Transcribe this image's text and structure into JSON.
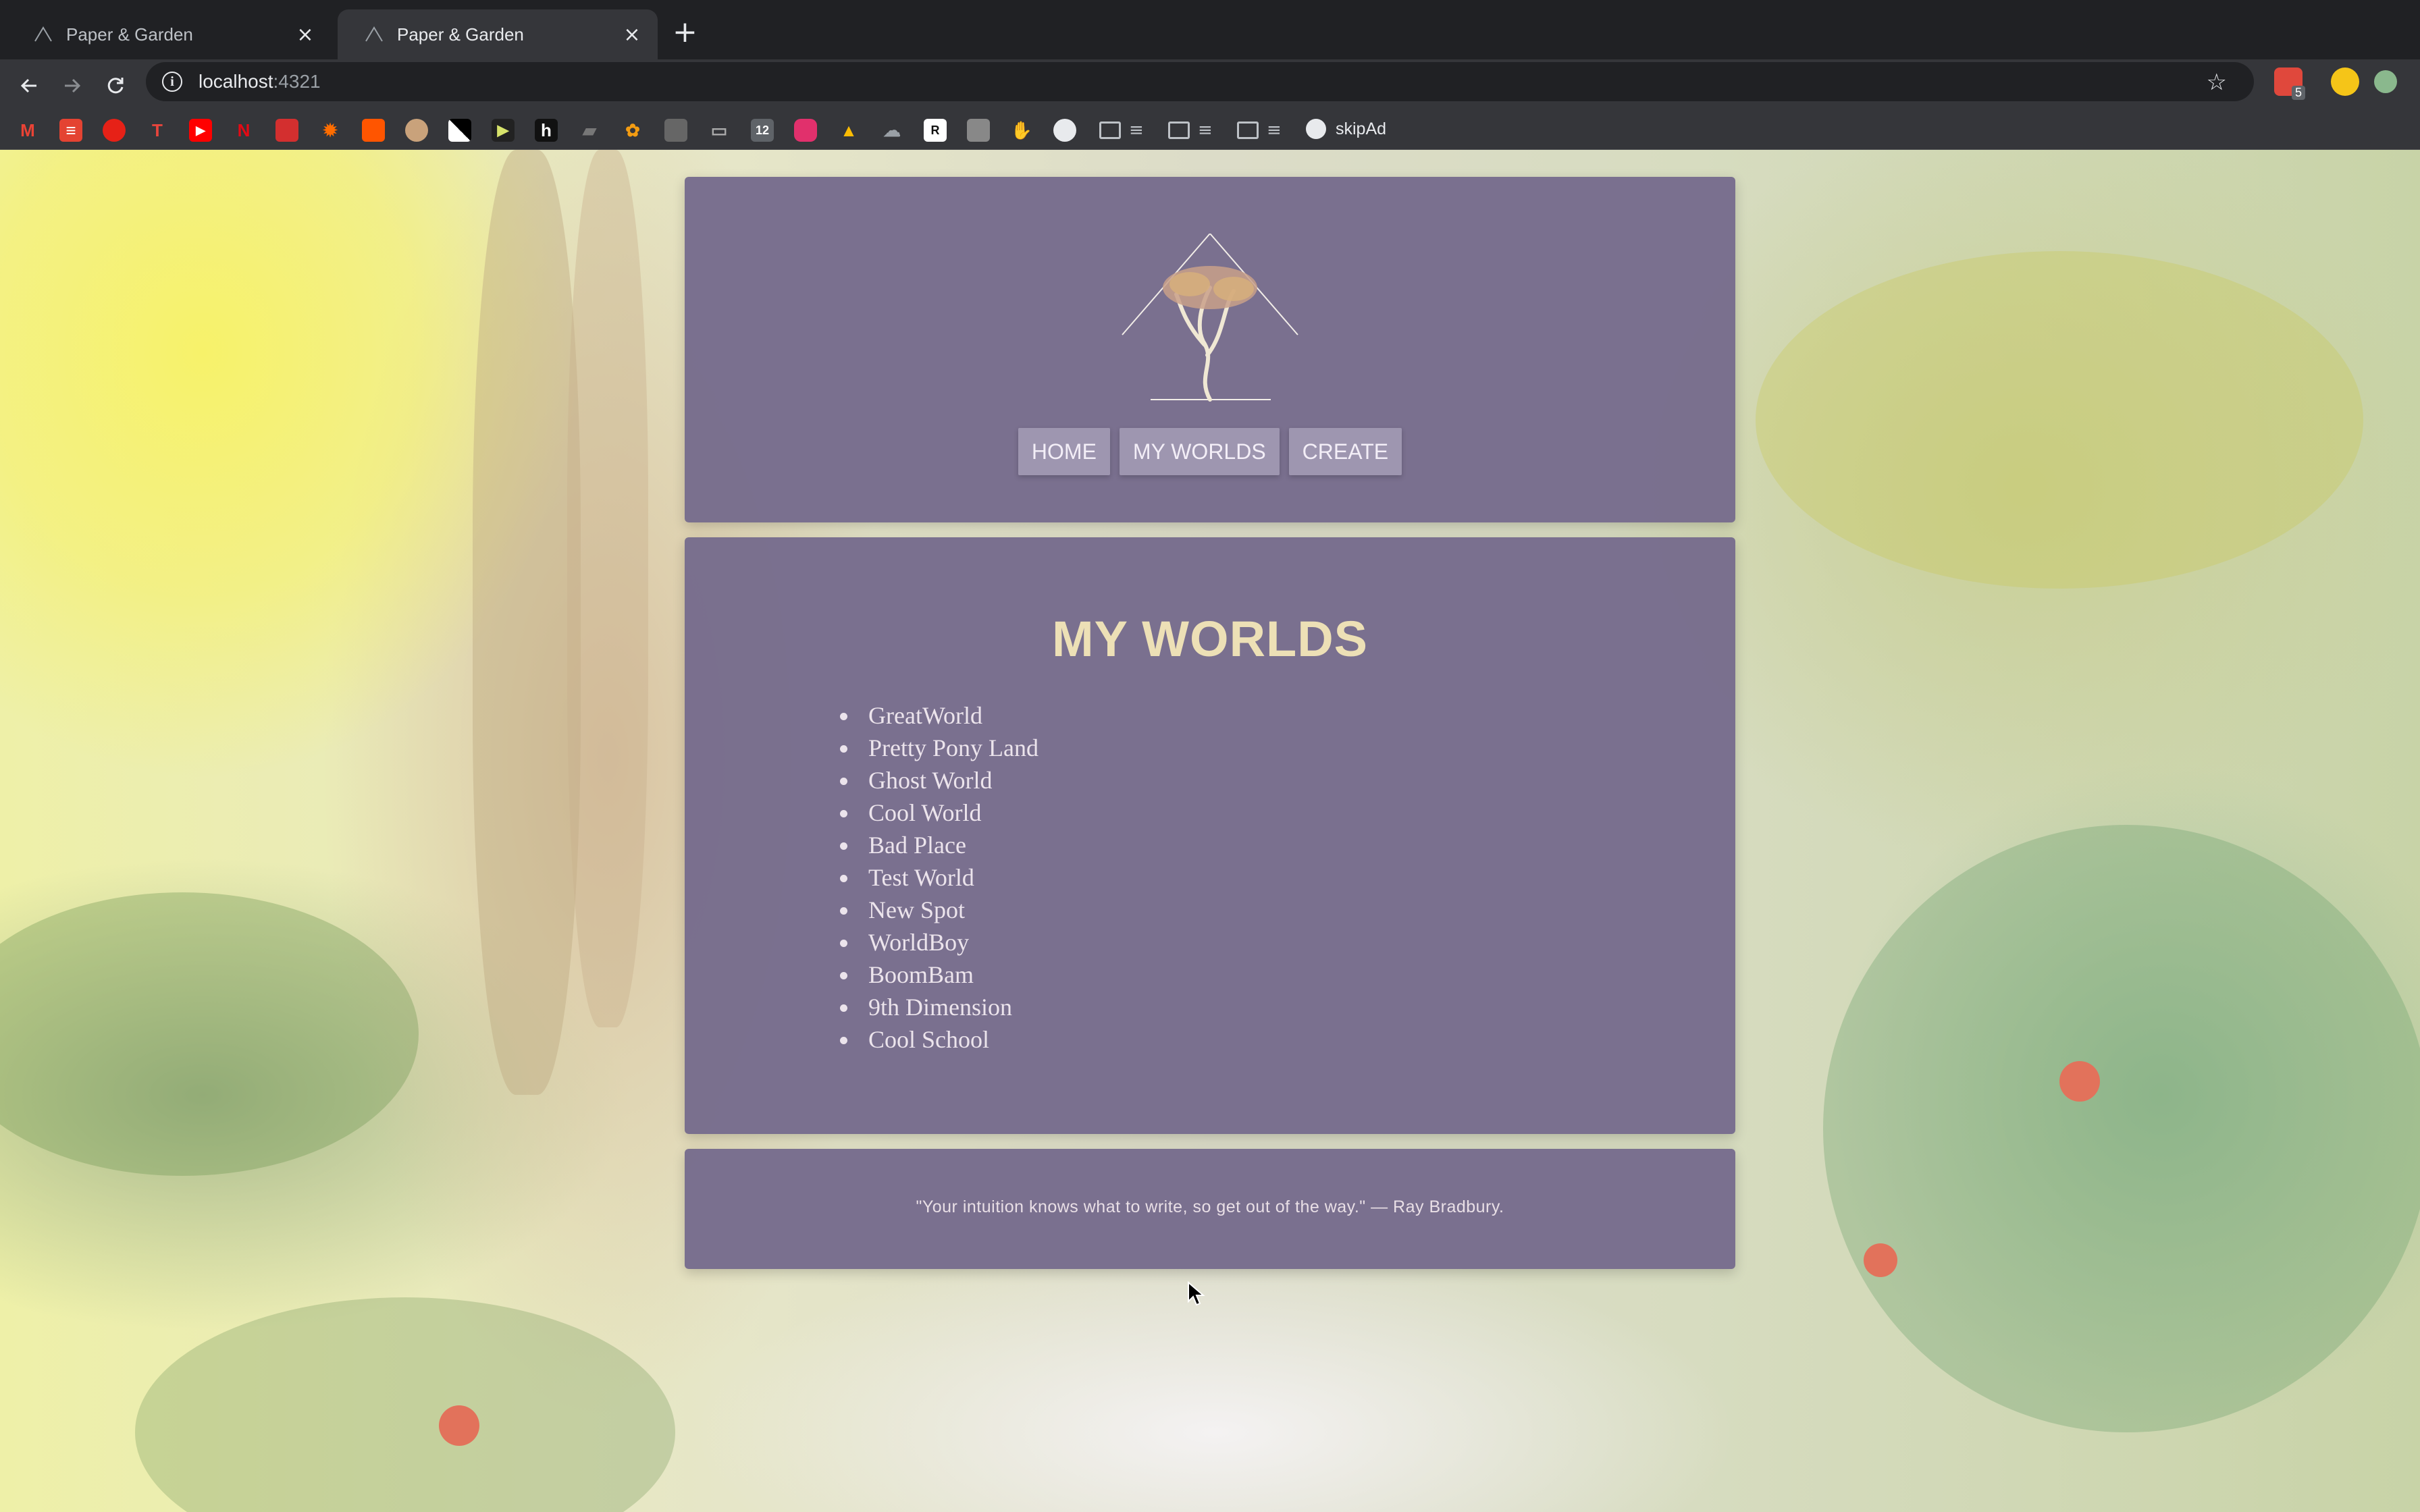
{
  "browser": {
    "tabs": [
      {
        "title": "Paper & Garden",
        "active": false
      },
      {
        "title": "Paper & Garden",
        "active": true
      }
    ],
    "url": {
      "host": "localhost",
      "port": ":4321"
    },
    "extension_badge": "5",
    "bookmark_skip_label": "skipAd",
    "bookmark_icons": [
      "gmail-icon",
      "todoist-icon",
      "record-icon",
      "t-icon",
      "youtube-icon",
      "netflix-icon",
      "acrobat-icon",
      "settings-sun-icon",
      "soundcloud-icon",
      "avatar-icon",
      "checker-icon",
      "film-icon",
      "h-icon",
      "stripe-icon",
      "paint-icon",
      "puzzle-icon",
      "tag-icon",
      "calendar-12-icon",
      "instagram-icon",
      "drive-icon",
      "cloud-icon",
      "rs-icon",
      "photo-icon",
      "hand-icon",
      "github-icon"
    ]
  },
  "site": {
    "nav": [
      "HOME",
      "MY WORLDS",
      "CREATE"
    ],
    "title": "MY WORLDS",
    "worlds": [
      "GreatWorld",
      "Pretty Pony Land",
      "Ghost World",
      "Cool World",
      "Bad Place",
      "Test World",
      "New Spot",
      "WorldBoy",
      "BoomBam",
      "9th Dimension",
      "Cool School"
    ],
    "quote": "\"Your intuition knows what to write, so get out of the way.\" — Ray Bradbury."
  },
  "colors": {
    "panel": "#766b8c",
    "title": "#ede0b6",
    "nav_button": "#a098b2"
  }
}
